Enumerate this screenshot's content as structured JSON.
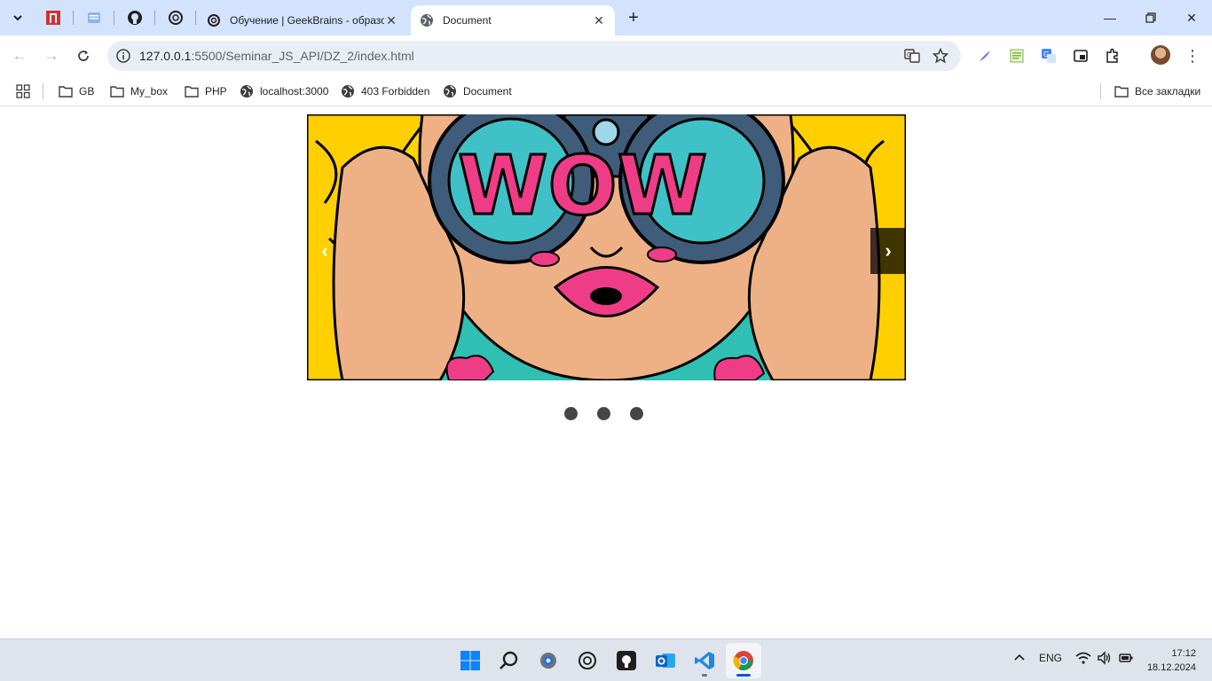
{
  "browser": {
    "tabs": [
      {
        "title": "Обучение | GeekBrains - образовательный портал",
        "favicon": "openai-style-icon"
      },
      {
        "title": "Document",
        "favicon": "globe-icon"
      }
    ],
    "url": "127.0.0.1:5500/Seminar_JS_API/DZ_2/index.html",
    "url_host": "127.0.0.1",
    "url_rest": ":5500/Seminar_JS_API/DZ_2/index.html"
  },
  "bookmarks": {
    "items": [
      {
        "label": "GB",
        "icon": "folder-icon"
      },
      {
        "label": "My_box",
        "icon": "folder-icon"
      },
      {
        "label": "PHP",
        "icon": "folder-icon"
      },
      {
        "label": "localhost:3000",
        "icon": "globe-icon"
      },
      {
        "label": "403 Forbidden",
        "icon": "globe-icon"
      },
      {
        "label": "Document",
        "icon": "globe-icon"
      }
    ],
    "all_bookmarks": "Все закладки"
  },
  "slider": {
    "prev": "‹",
    "next": "›",
    "image_text": "WOW",
    "dots_count": 3
  },
  "taskbar": {
    "lang": "ENG",
    "time": "17:12",
    "date": "18.12.2024"
  },
  "colors": {
    "tabstrip": "#d3e3fd",
    "accent": "#0b57d0"
  }
}
